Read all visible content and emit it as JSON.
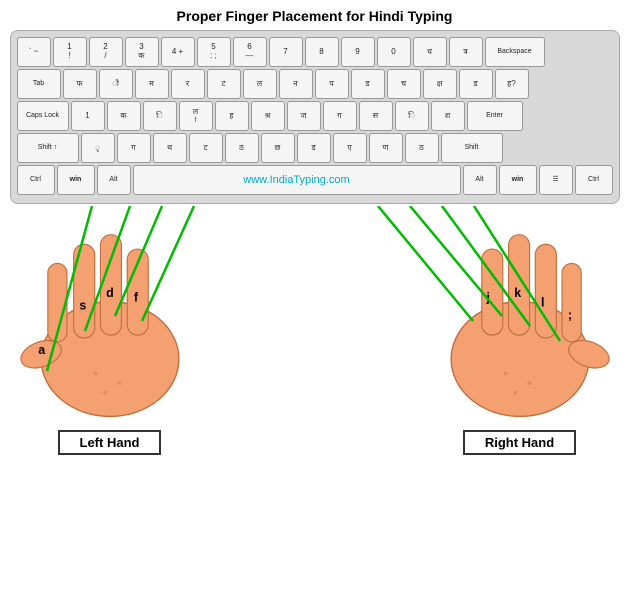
{
  "title": "Proper Finger Placement for Hindi Typing",
  "url_label": "www.IndiaTyping.com",
  "left_hand_label": "Left Hand",
  "right_hand_label": "Right Hand",
  "keyboard": {
    "row1": [
      "` ~",
      "1 !",
      "2 /",
      "3 ",
      "4 +",
      "5 : ;",
      "6 —",
      "7 ",
      "8 ",
      "9 ",
      "0 ",
      "- ",
      "= ",
      "त्र",
      "Backspace"
    ],
    "row2": [
      "Tab",
      "फ",
      "",
      "म",
      "र",
      "ट",
      "ल",
      "न",
      "प",
      "ड",
      "च",
      "क्ष",
      "ड",
      "ह?"
    ],
    "row3": [
      "Caps Lock",
      "1",
      "क",
      "ि",
      "ल",
      "श्र",
      "ज",
      "ग",
      "स",
      "ि",
      "श",
      "Enter"
    ],
    "row4": [
      "Shift ↑",
      "",
      "ग",
      "थ",
      "ट",
      "ठ",
      "छ",
      "ड",
      "ए",
      "ण",
      "ठ",
      "Shift"
    ],
    "row5": [
      "Ctrl",
      "win",
      "Alt",
      "",
      "Alt",
      "win",
      "",
      "Ctrl"
    ]
  },
  "finger_keys_left": [
    "a",
    "s",
    "d",
    "f"
  ],
  "finger_keys_right": [
    "j",
    "k",
    "l",
    ";"
  ]
}
